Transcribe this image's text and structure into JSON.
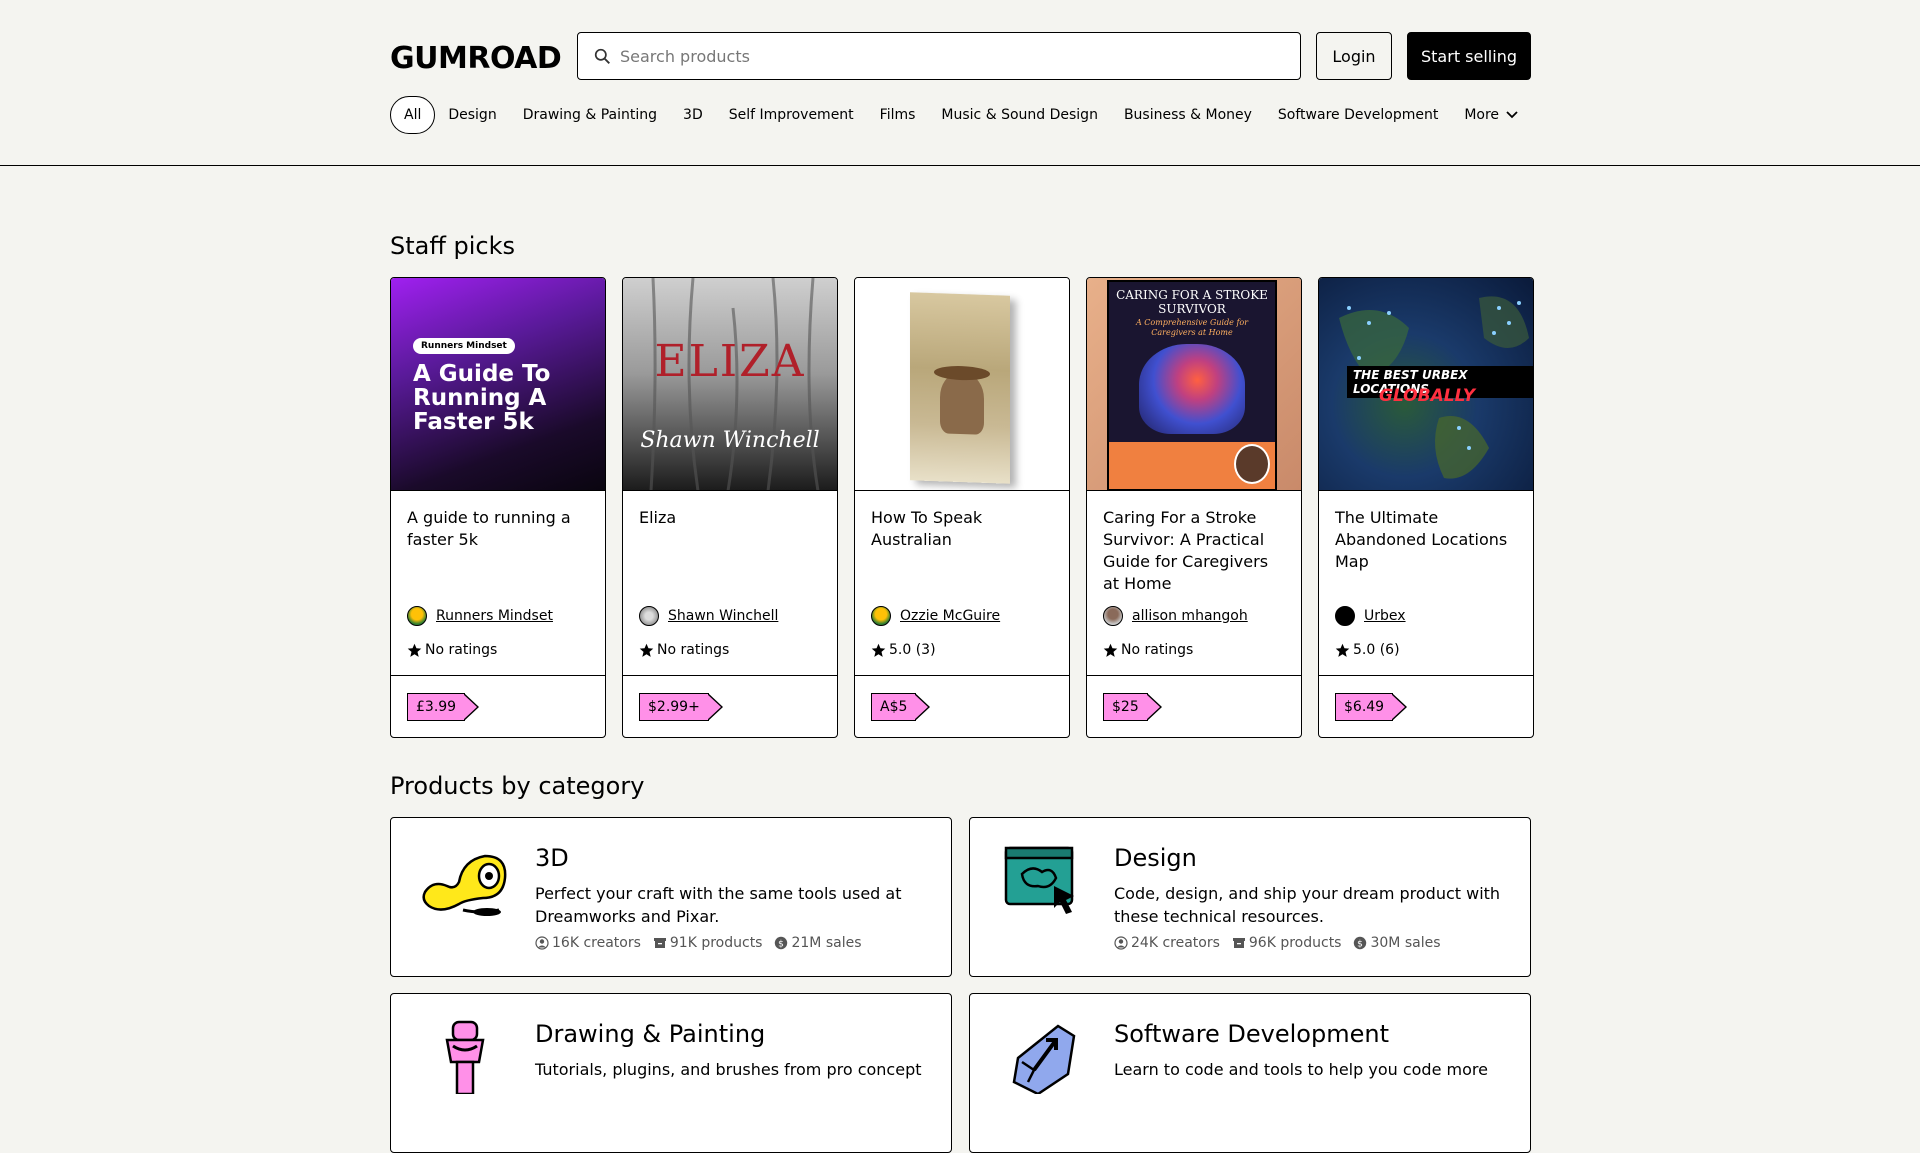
{
  "header": {
    "logo_text": "GUMROAD",
    "search_placeholder": "Search products",
    "login_label": "Login",
    "start_selling_label": "Start selling"
  },
  "nav": {
    "items": [
      "All",
      "Design",
      "Drawing & Painting",
      "3D",
      "Self Improvement",
      "Films",
      "Music & Sound Design",
      "Business & Money",
      "Software Development"
    ],
    "more_label": "More"
  },
  "staff_picks": {
    "title": "Staff picks",
    "cards": [
      {
        "title": "A guide to running a faster 5k",
        "creator": "Runners Mindset",
        "rating": "No ratings",
        "price": "£3.99",
        "cover_badge": "Runners Mindset",
        "cover_text": "A Guide To Running A Faster 5k"
      },
      {
        "title": "Eliza",
        "creator": "Shawn Winchell",
        "rating": "No ratings",
        "price": "$2.99+",
        "cover_text": "ELIZA",
        "cover_sub": "Shawn Winchell"
      },
      {
        "title": "How To Speak Australian",
        "creator": "Ozzie McGuire",
        "rating": "5.0 (3)",
        "price": "A$5"
      },
      {
        "title": "Caring For a Stroke Survivor: A Practical Guide for Caregivers at Home",
        "creator": "allison mhangoh",
        "rating": "No ratings",
        "price": "$25",
        "cover_text": "CARING FOR A STROKE SURVIVOR",
        "cover_sub": "A Comprehensive Guide for Caregivers at Home"
      },
      {
        "title": "The Ultimate Abandoned Locations Map",
        "creator": "Urbex",
        "rating": "5.0 (6)",
        "price": "$6.49",
        "cover_text": "THE BEST URBEX LOCATIONS",
        "cover_sub": "GLOBALLY"
      }
    ]
  },
  "categories": {
    "title": "Products by category",
    "items": [
      {
        "name": "3D",
        "desc": "Perfect your craft with the same tools used at Dreamworks and Pixar.",
        "creators": "16K creators",
        "products": "91K products",
        "sales": "21M sales"
      },
      {
        "name": "Design",
        "desc": "Code, design, and ship your dream product with these technical resources.",
        "creators": "24K creators",
        "products": "96K products",
        "sales": "30M sales"
      },
      {
        "name": "Drawing & Painting",
        "desc": "Tutorials, plugins, and brushes from pro concept",
        "creators": "",
        "products": "",
        "sales": ""
      },
      {
        "name": "Software Development",
        "desc": "Learn to code and tools to help you code more",
        "creators": "",
        "products": "",
        "sales": ""
      }
    ]
  },
  "colors": {
    "background": "#f4f4f0",
    "accent_pink": "#ff90e8",
    "black": "#000000"
  }
}
